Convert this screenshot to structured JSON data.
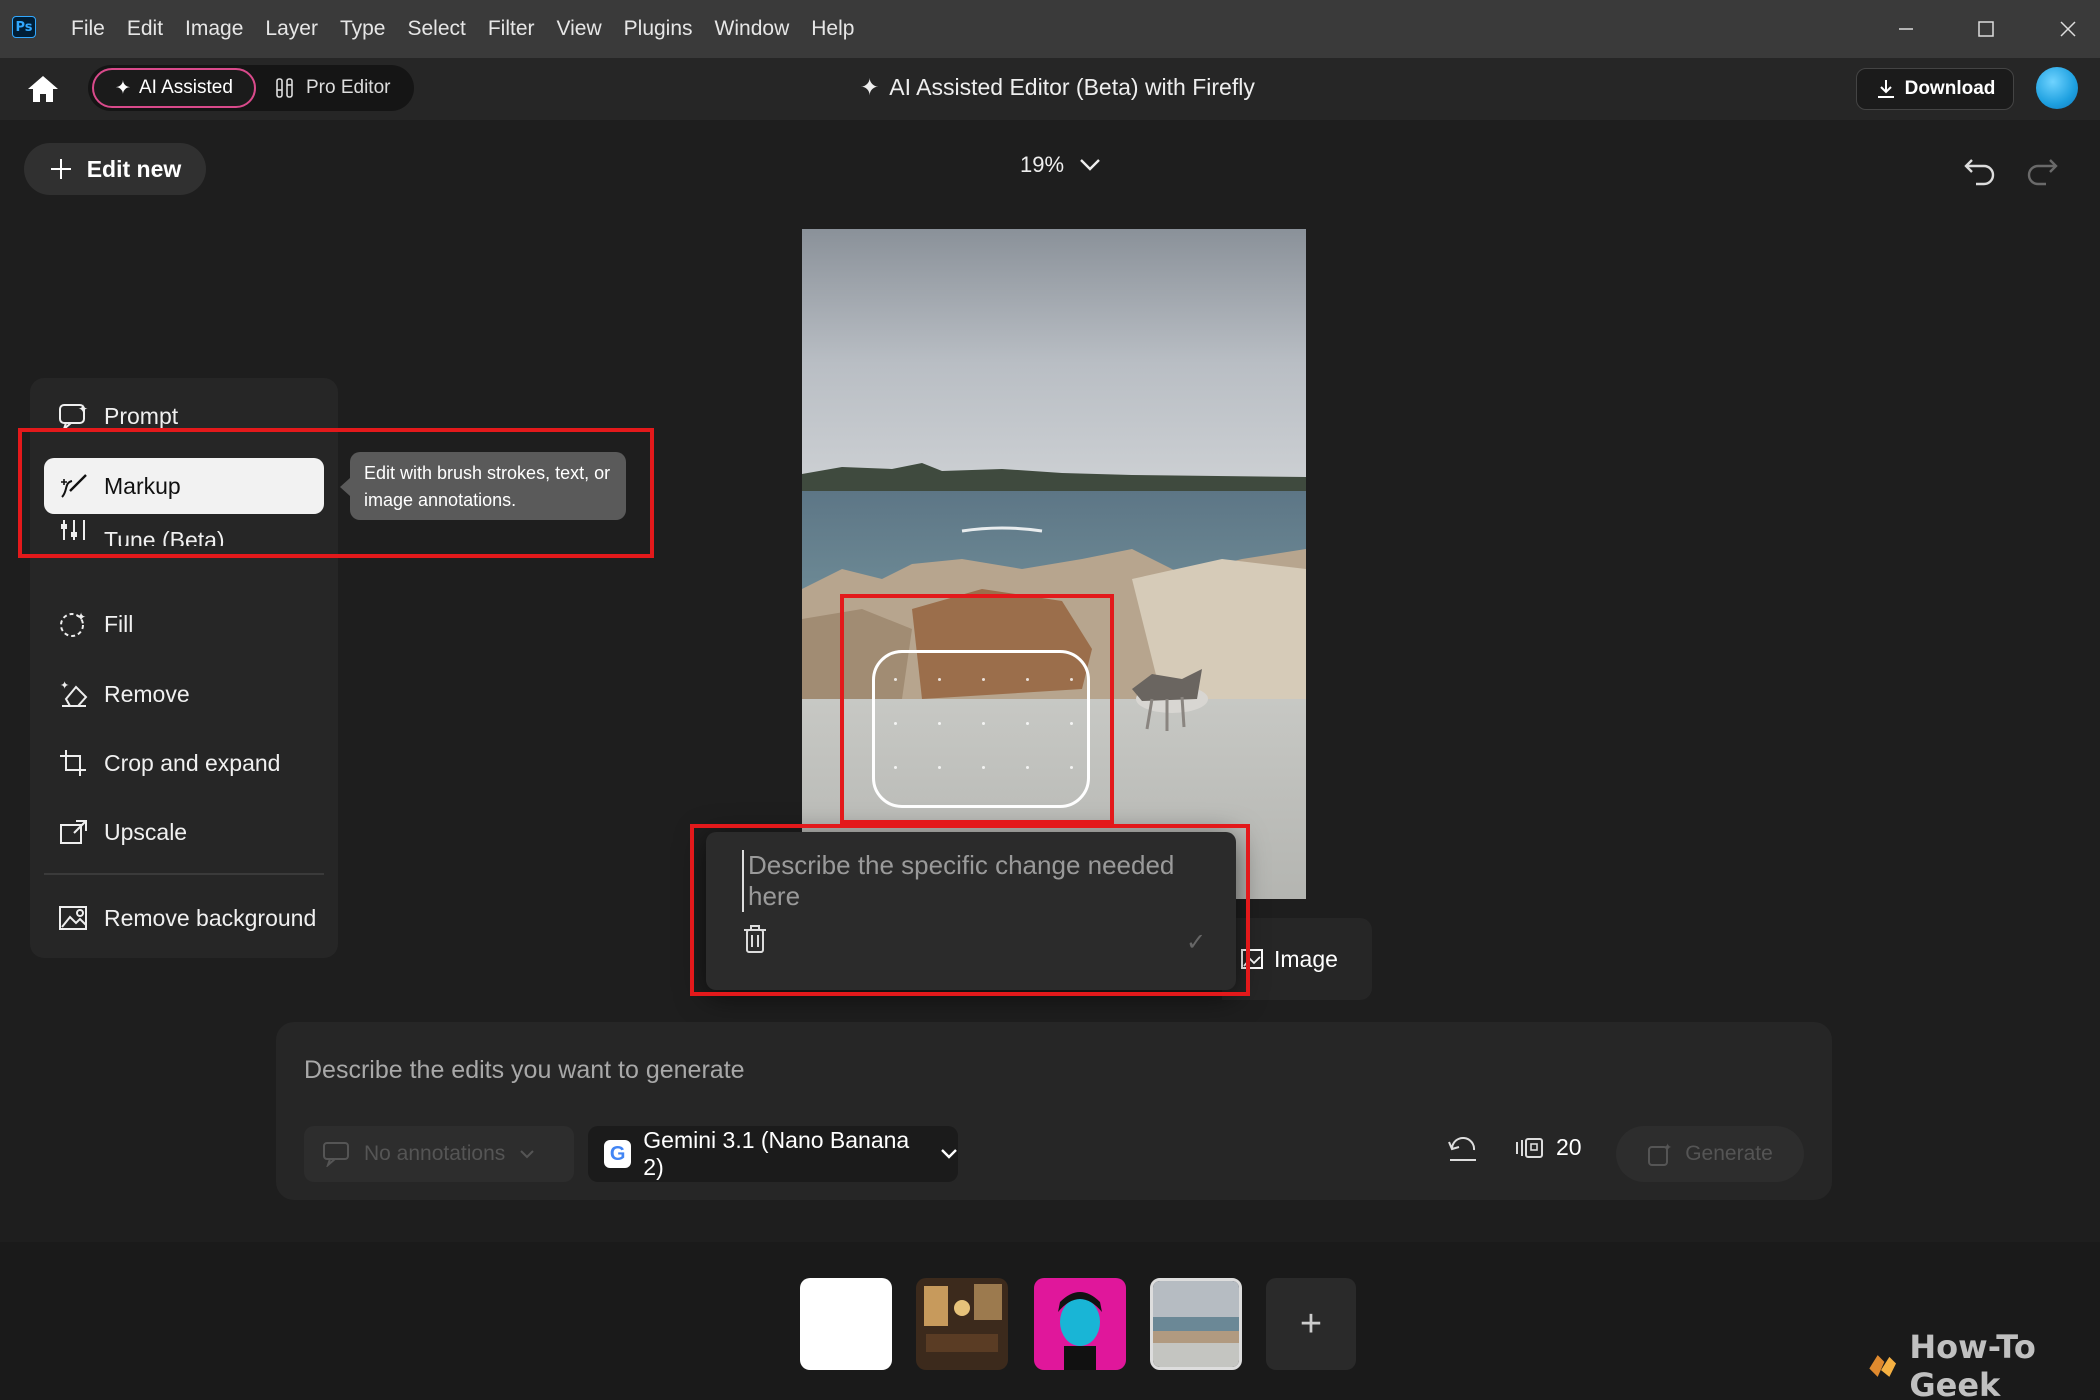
{
  "titlebar": {
    "logo": "Ps",
    "menu": [
      "File",
      "Edit",
      "Image",
      "Layer",
      "Type",
      "Select",
      "Filter",
      "View",
      "Plugins",
      "Window",
      "Help"
    ],
    "window_controls": [
      "minimize-icon",
      "maximize-icon",
      "close-icon"
    ]
  },
  "appbar": {
    "mode_ai": "AI Assisted",
    "mode_pro": "Pro Editor",
    "title": "AI Assisted Editor (Beta) with Firefly",
    "download": "Download"
  },
  "workspace": {
    "edit_new": "Edit new",
    "zoom": "19%"
  },
  "tools": {
    "items": [
      {
        "label": "Prompt",
        "icon": "prompt-icon"
      },
      {
        "label": "Markup",
        "icon": "markup-brush-icon",
        "active": true
      },
      {
        "label": "Tune (Beta)",
        "icon": "tune-icon"
      },
      {
        "label": "Fill",
        "icon": "fill-icon"
      },
      {
        "label": "Remove",
        "icon": "remove-eraser-icon"
      },
      {
        "label": "Crop and expand",
        "icon": "crop-icon"
      },
      {
        "label": "Upscale",
        "icon": "upscale-icon"
      },
      {
        "label": "Remove background",
        "icon": "remove-background-icon"
      }
    ],
    "tooltip": "Edit with brush strokes, text, or image annotations."
  },
  "annotation_popup": {
    "placeholder": "Describe the specific change needed here",
    "image_chip": "Image"
  },
  "promptbar": {
    "placeholder": "Describe the edits you want to generate",
    "annotations": "No annotations",
    "model": "Gemini 3.1 (Nano Banana 2)",
    "model_logo": "G",
    "credits": "20",
    "generate": "Generate"
  },
  "filmstrip": {
    "add": "+"
  },
  "watermark": "How-To Geek",
  "colors": {
    "accent_highlight": "#e3191b",
    "ai_mode_border": "#d94a8b",
    "avatar": "#1ea0e0"
  }
}
